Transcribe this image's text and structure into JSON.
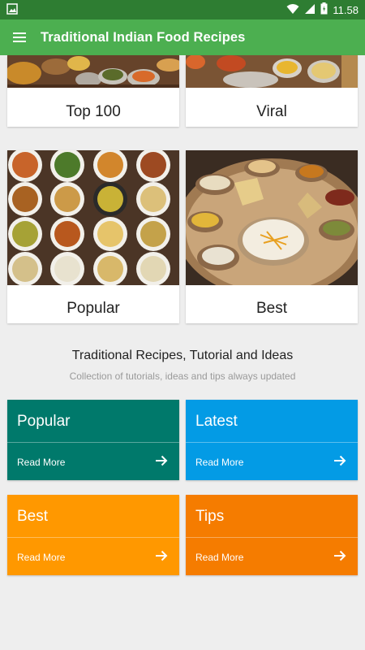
{
  "status": {
    "time": "11.58"
  },
  "toolbar": {
    "title": "Traditional Indian Food Recipes"
  },
  "categories": [
    {
      "label": "Top 100"
    },
    {
      "label": "Viral"
    },
    {
      "label": "Popular"
    },
    {
      "label": "Best"
    }
  ],
  "section": {
    "title": "Traditional Recipes, Tutorial and Ideas",
    "subtitle": "Collection of tutorials, ideas and tips always updated"
  },
  "tiles": [
    {
      "name": "Popular",
      "action": "Read More",
      "color": "#00796b"
    },
    {
      "name": "Latest",
      "action": "Read More",
      "color": "#039be5"
    },
    {
      "name": "Best",
      "action": "Read More",
      "color": "#ff9800"
    },
    {
      "name": "Tips",
      "action": "Read More",
      "color": "#f57c00"
    }
  ],
  "colors": {
    "statusbar": "#2e7d32",
    "toolbar": "#4caf50",
    "background": "#eeeeee"
  }
}
